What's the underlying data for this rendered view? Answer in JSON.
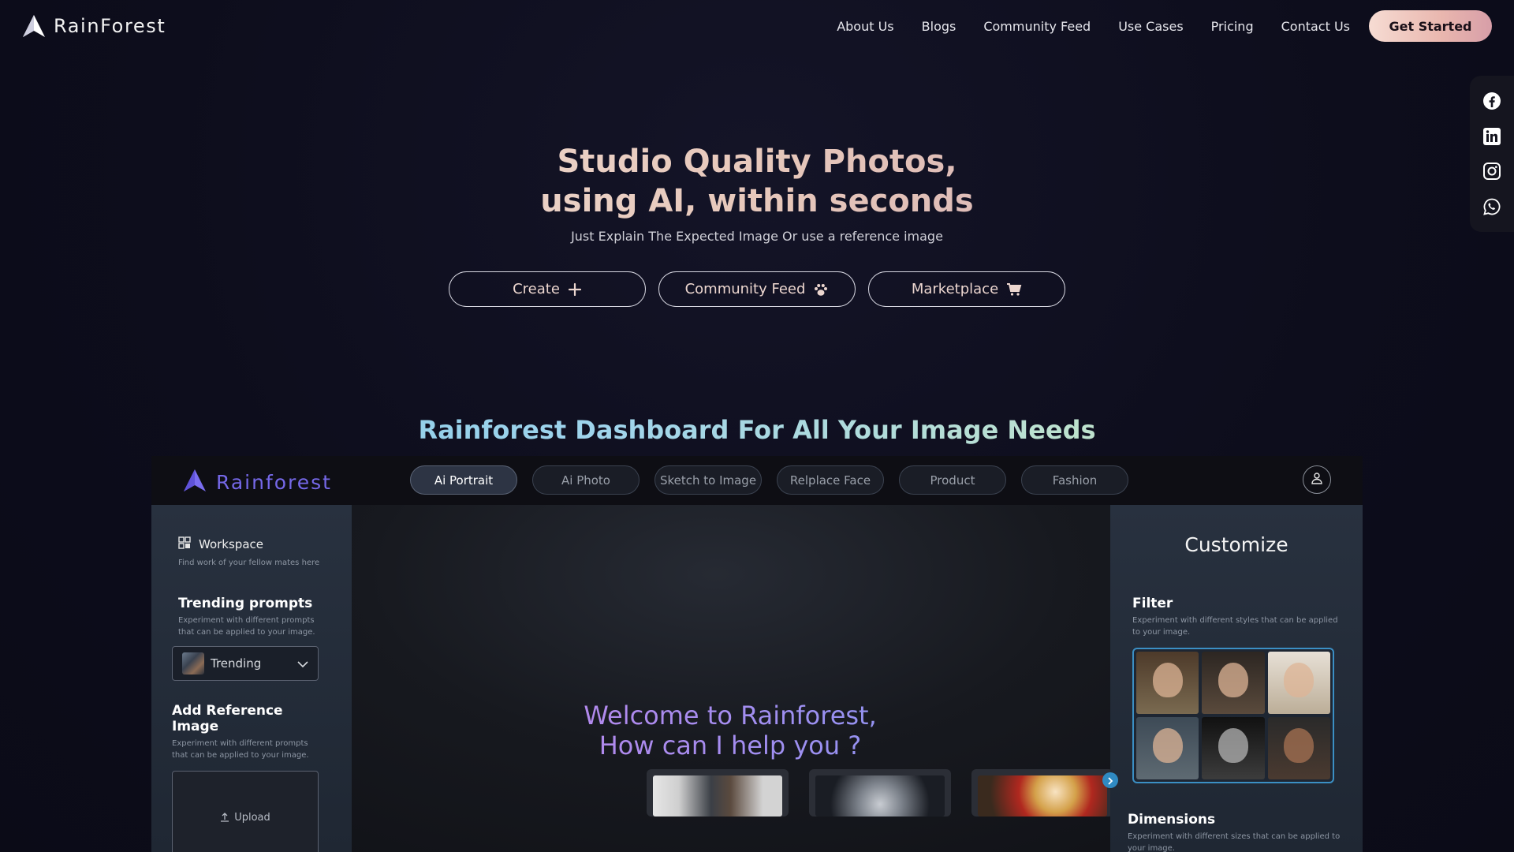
{
  "nav": {
    "brand": "RainForest",
    "links": [
      "About Us",
      "Blogs",
      "Community Feed",
      "Use Cases",
      "Pricing",
      "Contact Us"
    ],
    "cta": "Get Started"
  },
  "social": [
    "facebook-icon",
    "linkedin-icon",
    "instagram-icon",
    "whatsapp-icon"
  ],
  "hero": {
    "line1": "Studio Quality Photos,",
    "line2": "using AI, within seconds",
    "subtitle": "Just Explain The Expected Image Or use a reference image",
    "buttons": [
      {
        "label": "Create",
        "icon": "plus-icon"
      },
      {
        "label": "Community Feed",
        "icon": "paw-icon"
      },
      {
        "label": "Marketplace",
        "icon": "cart-icon"
      }
    ]
  },
  "dashboard": {
    "section_title": "Rainforest Dashboard For All Your Image Needs",
    "brand": "Rainforest",
    "tabs": [
      "Ai Portrait",
      "Ai Photo",
      "Sketch to Image",
      "Relplace Face",
      "Product",
      "Fashion"
    ],
    "active_tab": "Ai Portrait",
    "left": {
      "workspace_label": "Workspace",
      "workspace_desc": "Find work of your fellow mates here",
      "trending_title": "Trending prompts",
      "trending_desc": "Experiment with different prompts that can be applied to your image.",
      "trending_value": "Trending",
      "reference_title": "Add Reference Image",
      "reference_desc": "Experiment with different prompts that can be applied to your image.",
      "upload_label": "Upload"
    },
    "center": {
      "welcome_line1": "Welcome to Rainforest,",
      "welcome_line2": "How can I help you ?"
    },
    "right": {
      "title": "Customize",
      "filter_title": "Filter",
      "filter_desc": "Experiment with different styles that can be applied to your image.",
      "dimensions_title": "Dimensions",
      "dimensions_desc": "Experiment with different sizes that can be applied to your image."
    }
  },
  "colors": {
    "background": "#0d0d1c",
    "cta_gradient_start": "#f6dcd3",
    "dash_brand": "#7568e8",
    "filter_border": "#3b8fc4"
  }
}
